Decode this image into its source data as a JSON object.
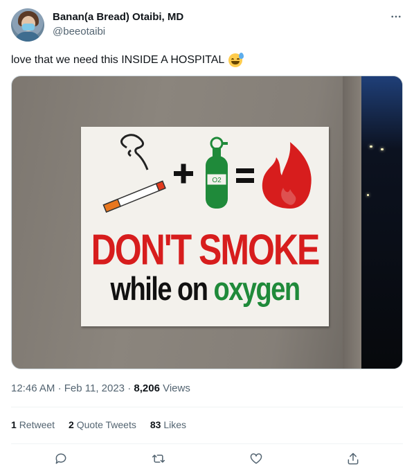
{
  "tweet": {
    "author_name": "Banan(a Bread) Otaibi, MD",
    "author_handle": "@beeotaibi",
    "text": "love that we need this INSIDE A HOSPITAL",
    "emoji": "grinning-face-with-sweat",
    "image": {
      "sign_line1": "DON'T SMOKE",
      "sign_line2_part1": "while on",
      "sign_line2_part2": "oxygen",
      "tank_label": "O2"
    },
    "time": "12:46 AM",
    "date": "Feb 11, 2023",
    "separator": "·",
    "views_count": "8,206",
    "views_label": "Views",
    "retweets_count": "1",
    "retweets_label": "Retweet",
    "quotes_count": "2",
    "quotes_label": "Quote Tweets",
    "likes_count": "83",
    "likes_label": "Likes"
  },
  "icons": {
    "more": "more-horizontal-icon",
    "reply": "reply-icon",
    "retweet": "retweet-icon",
    "like": "heart-icon",
    "share": "share-icon"
  },
  "colors": {
    "text_primary": "#0f1419",
    "text_secondary": "#536471",
    "sign_red": "#d71d1d",
    "sign_green": "#1f8a3a"
  }
}
